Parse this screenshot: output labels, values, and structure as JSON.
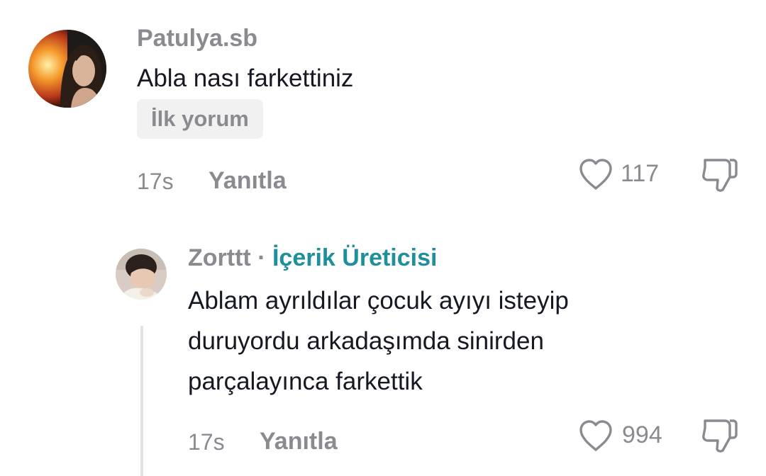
{
  "comments": [
    {
      "username": "Patulya.sb",
      "text": "Abla nası farkettiniz",
      "tag": "İlk yorum",
      "time": "17s",
      "reply_label": "Yanıtla",
      "likes": "117",
      "avatar_icon": "user-avatar-photo"
    }
  ],
  "replies": [
    {
      "username": "Zorttt",
      "separator": "·",
      "badge": "İçerik Üreticisi",
      "text_lines": [
        "Ablam ayrıldılar çocuk ayıyı isteyip",
        "duruyordu arkadaşımda sinirden",
        "parçalayınca farkettik"
      ],
      "time": "17s",
      "reply_label": "Yanıtla",
      "likes": "994",
      "avatar_icon": "user-avatar-photo"
    }
  ],
  "icons": {
    "like": "heart-outline-icon",
    "dislike": "thumbs-down-icon"
  },
  "colors": {
    "text": "#161823",
    "muted": "#8a8b91",
    "creator_badge": "#1f8f9b",
    "pill_bg": "#f1f1f2"
  }
}
